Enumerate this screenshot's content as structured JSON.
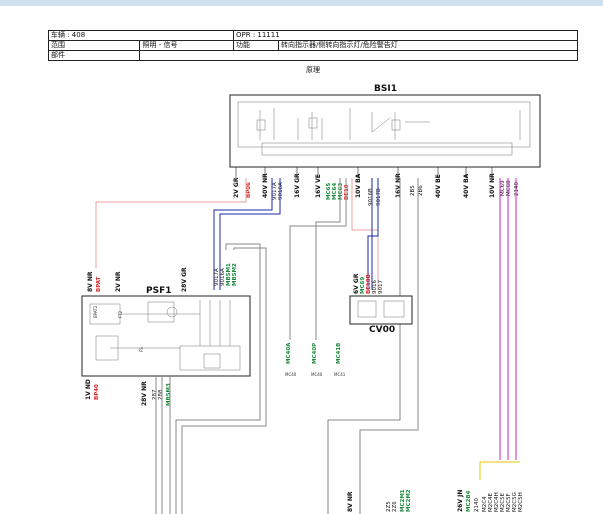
{
  "header": {
    "vehicle": "车辆 : 408",
    "opr": "OPR : 11111",
    "range_label": "范围",
    "range_value": "照明 - 信号",
    "function_label": "功能",
    "function_value": "转向指示器/侧转向指示灯/危险警告灯",
    "parts_label": "部件"
  },
  "section_title": "原理",
  "modules": {
    "bsi": "BSI1",
    "psf": "PSF1",
    "cv": "CV00"
  },
  "bsi_pins": [
    "2V GR",
    "40V NR",
    "16V GR",
    "16V VE",
    "10V BA",
    "16V NR",
    "40V BE",
    "40V BA",
    "10V NR"
  ],
  "bsi_wire_codes": [
    "BP06",
    "9017A",
    "9016A",
    "MC65",
    "MC64",
    "MC63",
    "BE10",
    "9016B",
    "9017B",
    "2B5",
    "2B6",
    "MC69",
    "MC68",
    "2140"
  ],
  "psf_pins_top": [
    "28V GR"
  ],
  "psf_wire_codes_top": [
    "9017A",
    "9016A",
    "MB5M1",
    "MB5M2"
  ],
  "psf_pins_left": [
    "8V NR",
    "2V NR",
    "BPAT",
    "BPAT2",
    "FT2",
    "FS"
  ],
  "psf_bottom": [
    "1V ND",
    "28V NR",
    "BP40",
    "287",
    "288",
    "MB5M3"
  ],
  "cv_pins": [
    "6V GR",
    "MC69",
    "BE10B",
    "9016",
    "9017"
  ],
  "ground_codes": [
    "MC40A",
    "MC40",
    "MC40P",
    "MC40",
    "MC41B",
    "MC41"
  ],
  "bottom_labels": [
    "8V NR",
    "2Z5",
    "2Z6",
    "MC2M1",
    "MC2M2",
    "26V JN",
    "MC2B4",
    "2140",
    "M2C4",
    "M2C4E",
    "M2C4H",
    "M2C5E",
    "M2C5F",
    "M2C5G",
    "M2C5H"
  ],
  "colors": {
    "red_wire": "#e8a0a0",
    "blue_wire": "#1a2aa8",
    "green_wire": "#1a8a3a",
    "magenta_wire": "#d020c0",
    "yellow_wire": "#e8c800",
    "gray_wire": "#888888"
  }
}
